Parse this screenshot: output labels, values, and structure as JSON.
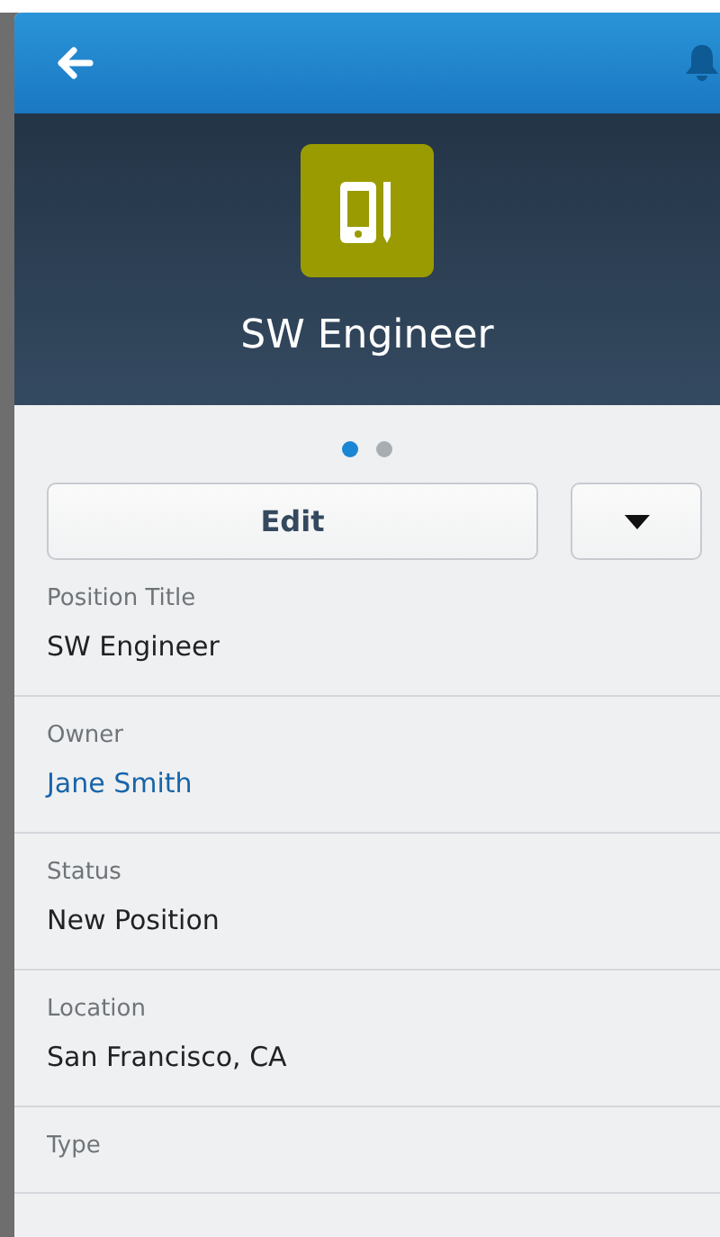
{
  "header": {
    "title": "SW Engineer"
  },
  "pager": [
    {
      "selected": true
    },
    {
      "selected": false
    }
  ],
  "actions": {
    "edit": "Edit"
  },
  "fields": [
    {
      "label": "Position Title",
      "value": "SW Engineer",
      "kind": "text"
    },
    {
      "label": "Owner",
      "value": "Jane Smith",
      "kind": "link"
    },
    {
      "label": "Status",
      "value": "New Position",
      "kind": "text"
    },
    {
      "label": "Location",
      "value": "San Francisco, CA",
      "kind": "text"
    },
    {
      "label": "Type"
    }
  ]
}
